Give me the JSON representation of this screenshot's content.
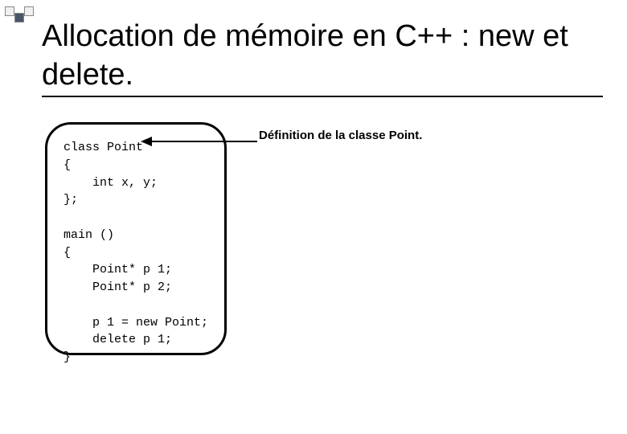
{
  "title": "Allocation de mémoire en C++ : new et delete.",
  "code": "class Point\n{\n    int x, y;\n};\n\nmain ()\n{\n    Point* p 1;\n    Point* p 2;\n\n    p 1 = new Point;\n    delete p 1;\n}",
  "annotation": "Définition de la classe Point."
}
